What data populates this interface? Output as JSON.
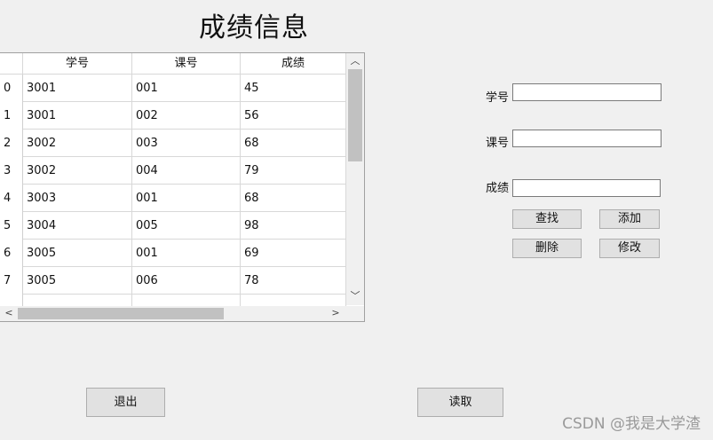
{
  "window": {
    "title": "成绩信息"
  },
  "table": {
    "headers": [
      "学号",
      "课号",
      "成绩"
    ],
    "rows": [
      {
        "index": "0",
        "student_id": "3001",
        "course_id": "001",
        "score": "45"
      },
      {
        "index": "1",
        "student_id": "3001",
        "course_id": "002",
        "score": "56"
      },
      {
        "index": "2",
        "student_id": "3002",
        "course_id": "003",
        "score": "68"
      },
      {
        "index": "3",
        "student_id": "3002",
        "course_id": "004",
        "score": "79"
      },
      {
        "index": "4",
        "student_id": "3003",
        "course_id": "001",
        "score": "68"
      },
      {
        "index": "5",
        "student_id": "3004",
        "course_id": "005",
        "score": "98"
      },
      {
        "index": "6",
        "student_id": "3005",
        "course_id": "001",
        "score": "69"
      },
      {
        "index": "7",
        "student_id": "3005",
        "course_id": "006",
        "score": "78"
      }
    ]
  },
  "form": {
    "student_id_label": "学号",
    "student_id_value": "",
    "course_id_label": "课号",
    "course_id_value": "",
    "score_label": "成绩",
    "score_value": ""
  },
  "buttons": {
    "search": "查找",
    "add": "添加",
    "delete": "删除",
    "modify": "修改",
    "exit": "退出",
    "read": "读取"
  },
  "watermark": "CSDN @我是大学渣"
}
